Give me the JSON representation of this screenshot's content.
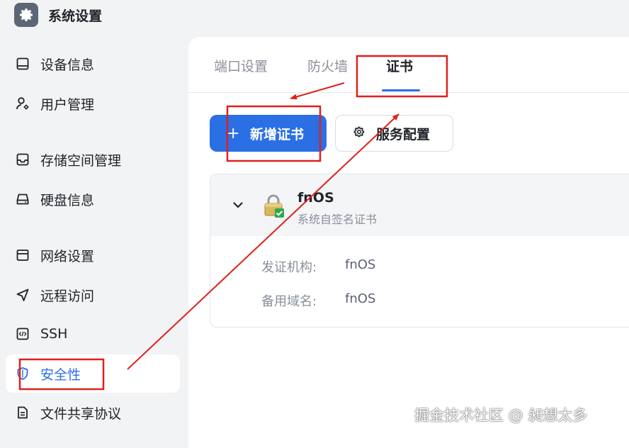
{
  "app": {
    "title": "系统设置",
    "icon": "gear-icon"
  },
  "sidebar": {
    "items": [
      {
        "label": "设备信息",
        "icon": "device-info-icon",
        "active": false
      },
      {
        "label": "用户管理",
        "icon": "user-settings-icon",
        "active": false
      },
      {
        "label": "存储空间管理",
        "icon": "storage-icon",
        "active": false
      },
      {
        "label": "硬盘信息",
        "icon": "harddisk-icon",
        "active": false
      },
      {
        "label": "网络设置",
        "icon": "network-icon",
        "active": false
      },
      {
        "label": "远程访问",
        "icon": "send-icon",
        "active": false
      },
      {
        "label": "SSH",
        "icon": "terminal-code-icon",
        "active": false
      },
      {
        "label": "安全性",
        "icon": "shield-icon",
        "active": true
      },
      {
        "label": "文件共享协议",
        "icon": "file-share-icon",
        "active": false
      }
    ]
  },
  "tabs": [
    {
      "label": "端口设置",
      "active": false
    },
    {
      "label": "防火墙",
      "active": false
    },
    {
      "label": "证书",
      "active": true
    }
  ],
  "toolbar": {
    "add_cert_label": "新增证书",
    "add_cert_icon": "plus-icon",
    "service_config_label": "服务配置",
    "service_config_icon": "gear-icon"
  },
  "certificate": {
    "name": "fnOS",
    "subtitle": "系统自签名证书",
    "icon": "lock-verified-icon",
    "issuer_label": "发证机构:",
    "issuer_value": "fnOS",
    "alt_domain_label": "备用域名:",
    "alt_domain_value": "fnOS"
  },
  "watermark": "掘金技术社区 @ 昶想太多",
  "colors": {
    "accent": "#2b6fe5",
    "annotation": "#e0201b",
    "sidebar_bg": "#f2f3f5",
    "panel_bg": "#ffffff"
  }
}
